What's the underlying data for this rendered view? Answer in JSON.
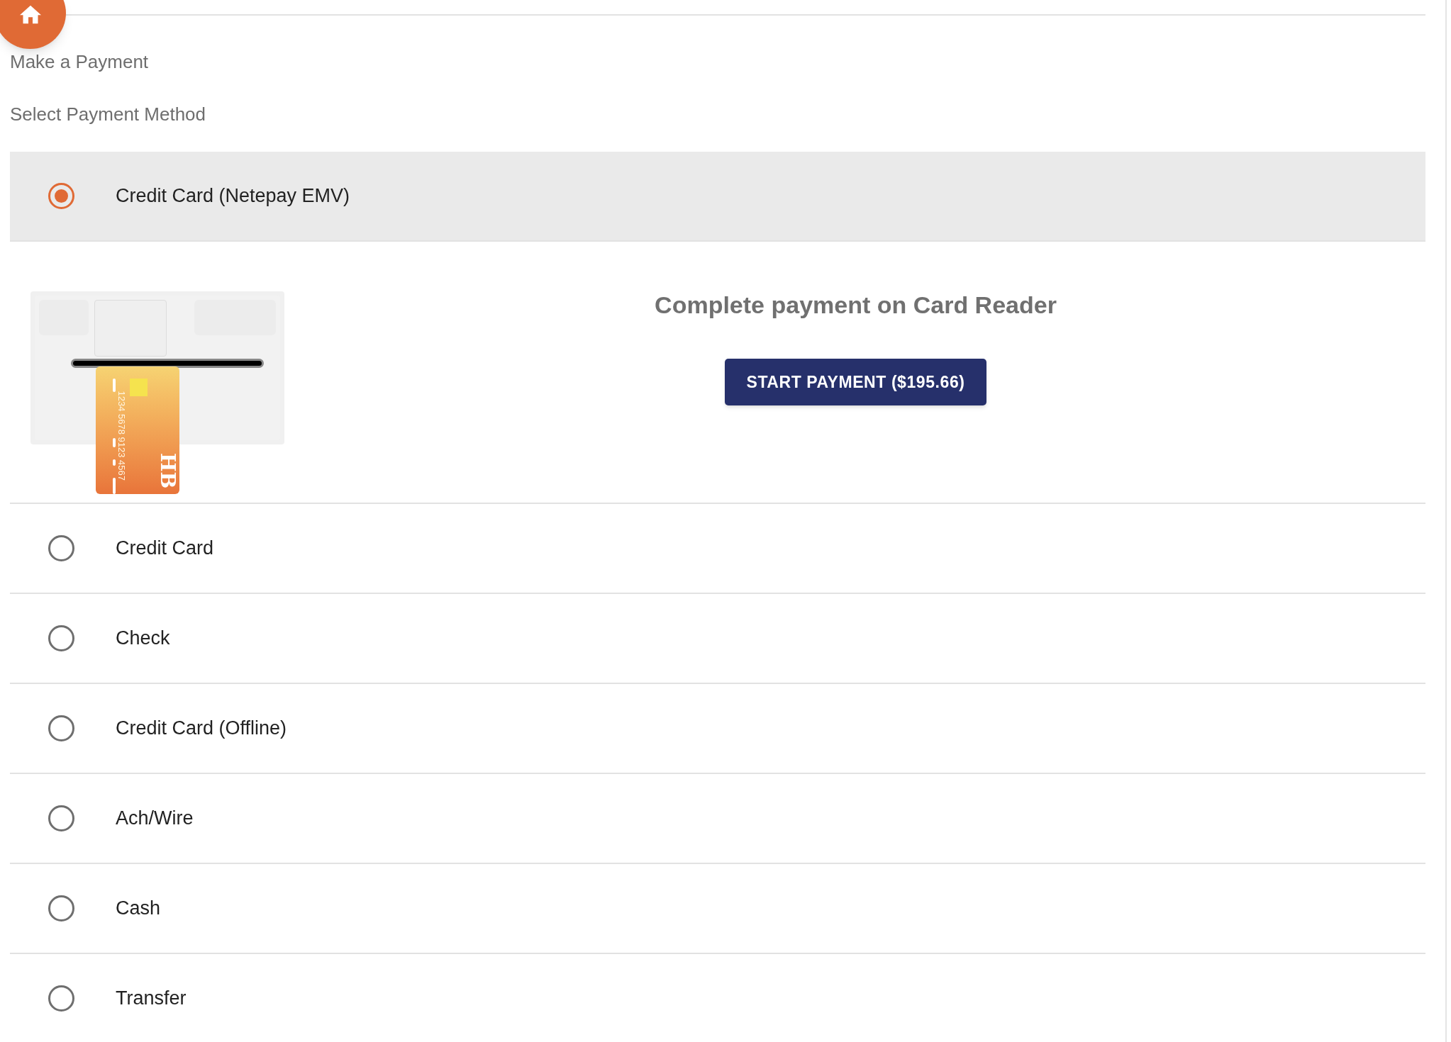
{
  "page_title": "Make a Payment",
  "section_label": "Select Payment Method",
  "payment_methods": [
    {
      "label": "Credit Card (Netepay EMV)",
      "selected": true
    },
    {
      "label": "Credit Card",
      "selected": false
    },
    {
      "label": "Check",
      "selected": false
    },
    {
      "label": "Credit Card (Offline)",
      "selected": false
    },
    {
      "label": "Ach/Wire",
      "selected": false
    },
    {
      "label": "Cash",
      "selected": false
    },
    {
      "label": "Transfer",
      "selected": false
    }
  ],
  "card_reader_panel": {
    "heading": "Complete payment on Card Reader",
    "button": "START PAYMENT ($195.66)",
    "card_number": "1234 5678 9123 4567",
    "card_logo": "HB"
  }
}
